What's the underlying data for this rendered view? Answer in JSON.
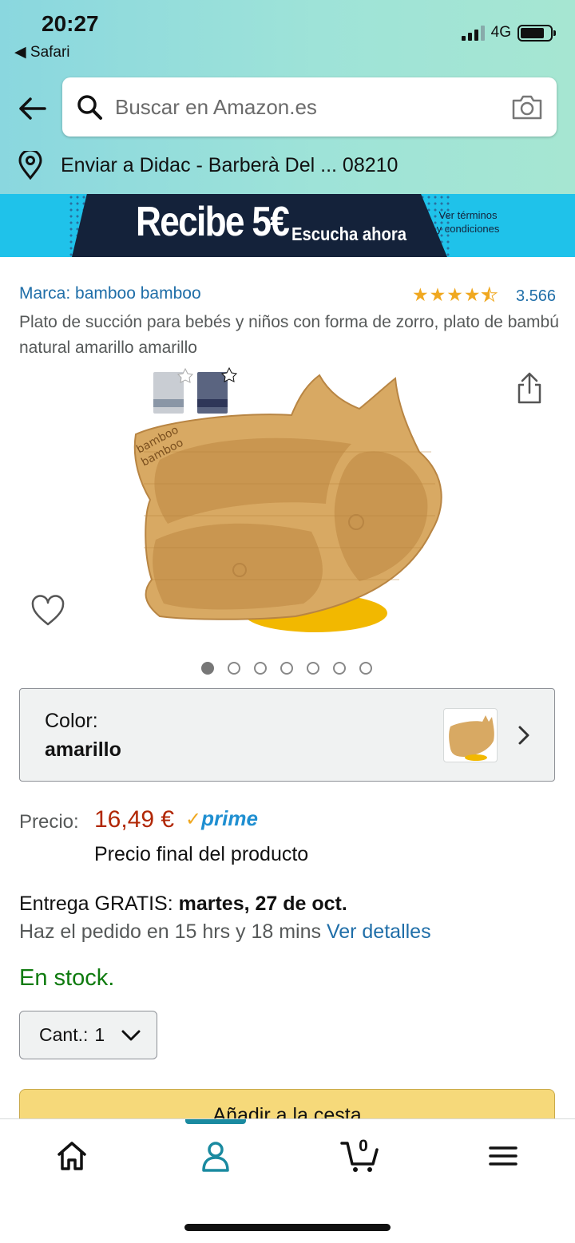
{
  "status_bar": {
    "time": "20:27",
    "back_app": "◀ Safari",
    "network": "4G"
  },
  "search": {
    "placeholder": "Buscar en Amazon.es"
  },
  "delivery_location": "Enviar a Didac - Barberà Del ... 08210",
  "banner": {
    "headline": "Recibe 5€",
    "subline": "Escucha ahora",
    "terms": "Ver términos y condiciones"
  },
  "product": {
    "brand": "Marca: bamboo bamboo",
    "rating_stars": 4.5,
    "rating_count": "3.566",
    "title": "Plato de succión para bebés y niños con forma de zorro, plato de bambú natural amarillo amarillo",
    "image_count": 7,
    "active_image": 1
  },
  "color_selector": {
    "label": "Color:",
    "value": "amarillo"
  },
  "price": {
    "label": "Precio:",
    "value": "16,49 €",
    "prime": "prime",
    "note": "Precio final del producto"
  },
  "delivery": {
    "prefix": "Entrega GRATIS: ",
    "date": "martes, 27 de oct.",
    "order_prefix": "Haz el pedido en 15 hrs y 18 mins ",
    "details_link": "Ver detalles"
  },
  "stock": "En stock.",
  "quantity": {
    "label": "Cant.:",
    "value": "1"
  },
  "add_to_cart": "Añadir a la cesta",
  "bottom_nav": {
    "cart_count": "0",
    "active": "account"
  },
  "colors": {
    "link": "#1f6ea8",
    "price": "#b12704",
    "in_stock": "#0f7b0f",
    "nav_accent": "#1a8aa0"
  }
}
